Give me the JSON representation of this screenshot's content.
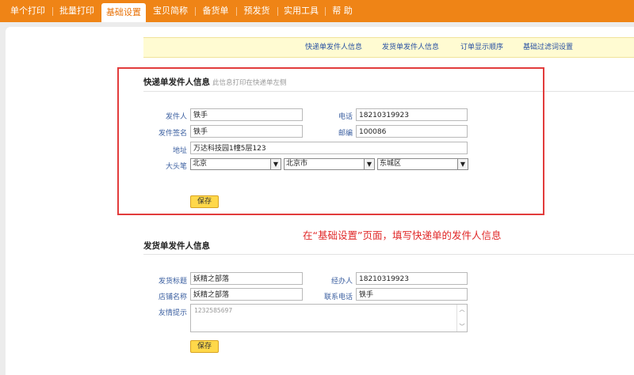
{
  "topnav": {
    "items": [
      "单个打印",
      "批量打印",
      "基础设置",
      "宝贝简称",
      "备货单",
      "预发货",
      "实用工具",
      "帮 助"
    ],
    "active": "基础设置"
  },
  "subnav": {
    "items": [
      "快递单发件人信息",
      "发货单发件人信息",
      "订单显示顺序",
      "基础过滤词设置"
    ]
  },
  "express_sender": {
    "title": "快递单发件人信息",
    "note": "此信息打印在快递单左侧",
    "labels": {
      "sender": "发件人",
      "phone": "电话",
      "signature": "发件签名",
      "zip": "邮编",
      "address": "地址",
      "region": "大头笔"
    },
    "values": {
      "sender": "铁手",
      "phone": "18210319923",
      "signature": "铁手",
      "zip": "100086",
      "address": "万达科技园1幢5层123"
    },
    "region": {
      "province": "北京",
      "city": "北京市",
      "district": "东城区"
    },
    "save_label": "保存"
  },
  "annotation": "在“基础设置”页面，填写快递单的发件人信息",
  "invoice_sender": {
    "title": "发货单发件人信息",
    "labels": {
      "title_field": "发货标题",
      "handler": "经办人",
      "shop_name": "店铺名称",
      "contact_phone": "联系电话",
      "tip": "友情提示"
    },
    "values": {
      "title_field": "妖精之部落",
      "handler": "18210319923",
      "shop_name": "妖精之部落",
      "contact_phone": "铁手",
      "tip": "1232585697"
    },
    "save_label": "保存"
  },
  "colors": {
    "nav": "#ef8416",
    "highlight": "#e23c3c",
    "annotation": "#e02828",
    "link": "#2851a3"
  },
  "icons": {
    "dropdown": "chevron-down-icon"
  }
}
